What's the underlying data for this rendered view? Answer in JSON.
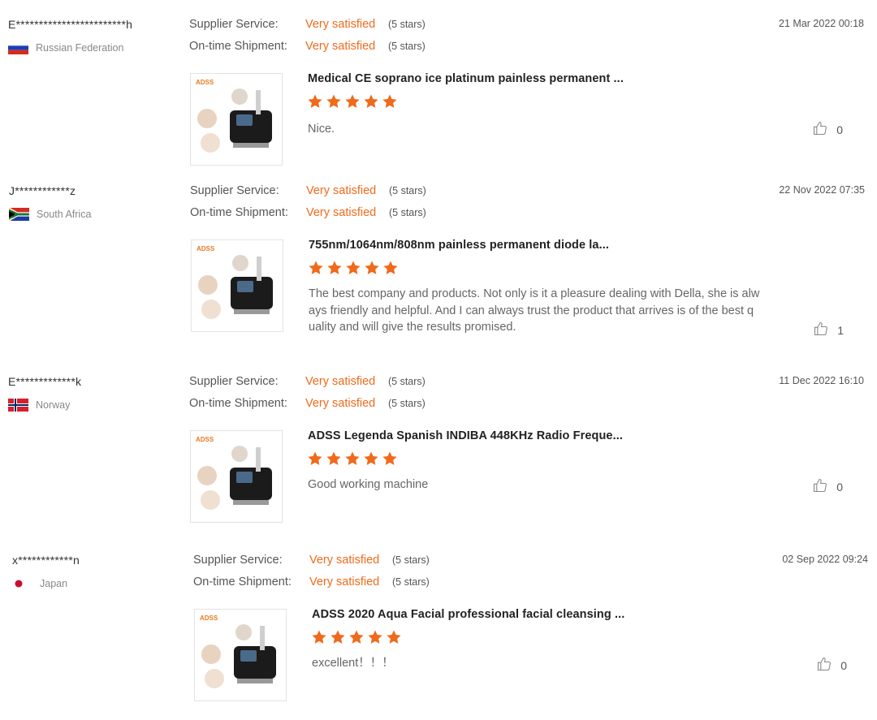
{
  "labels": {
    "supplier_service": "Supplier Service:",
    "ontime_shipment": "On-time Shipment:"
  },
  "colors": {
    "accent": "#f06a1b",
    "star": "#f06a1b"
  },
  "reviews": [
    {
      "reviewer": "E************************h",
      "country": "Russian Federation",
      "flag": "russia",
      "supplier_rating": "Very satisfied",
      "supplier_stars": "(5 stars)",
      "shipment_rating": "Very satisfied",
      "shipment_stars": "(5 stars)",
      "date": "21 Mar 2022 00:18",
      "product_logo": "ADSS",
      "product_title": "Medical CE soprano ice platinum painless permanent ...",
      "stars": 5,
      "comment": "Nice.",
      "likes": "0"
    },
    {
      "reviewer": "J************z",
      "country": "South Africa",
      "flag": "south-africa",
      "supplier_rating": "Very satisfied",
      "supplier_stars": "(5 stars)",
      "shipment_rating": "Very satisfied",
      "shipment_stars": "(5 stars)",
      "date": "22 Nov 2022 07:35",
      "product_logo": "ADSS",
      "product_title": "755nm/1064nm/808nm painless permanent diode la...",
      "stars": 5,
      "comment": "The best company and products. Not only is it a pleasure dealing with Della, she is always friendly and helpful. And I can always trust the product that arrives is of the best quality and will give the results promised.",
      "likes": "1"
    },
    {
      "reviewer": "E*************k",
      "country": "Norway",
      "flag": "norway",
      "supplier_rating": "Very satisfied",
      "supplier_stars": "(5 stars)",
      "shipment_rating": "Very satisfied",
      "shipment_stars": "(5 stars)",
      "date": "11 Dec 2022 16:10",
      "product_logo": "ADSS",
      "product_title": "ADSS Legenda Spanish INDIBA 448KHz Radio Freque...",
      "stars": 5,
      "comment": "Good working machine",
      "likes": "0"
    },
    {
      "reviewer": "x************n",
      "country": "Japan",
      "flag": "japan",
      "supplier_rating": "Very satisfied",
      "supplier_stars": "(5 stars)",
      "shipment_rating": "Very satisfied",
      "shipment_stars": "(5 stars)",
      "date": "02 Sep 2022 09:24",
      "product_logo": "ADSS",
      "product_title": "ADSS 2020 Aqua Facial professional facial cleansing ...",
      "stars": 5,
      "comment": "excellent！！！",
      "likes": "0"
    }
  ]
}
